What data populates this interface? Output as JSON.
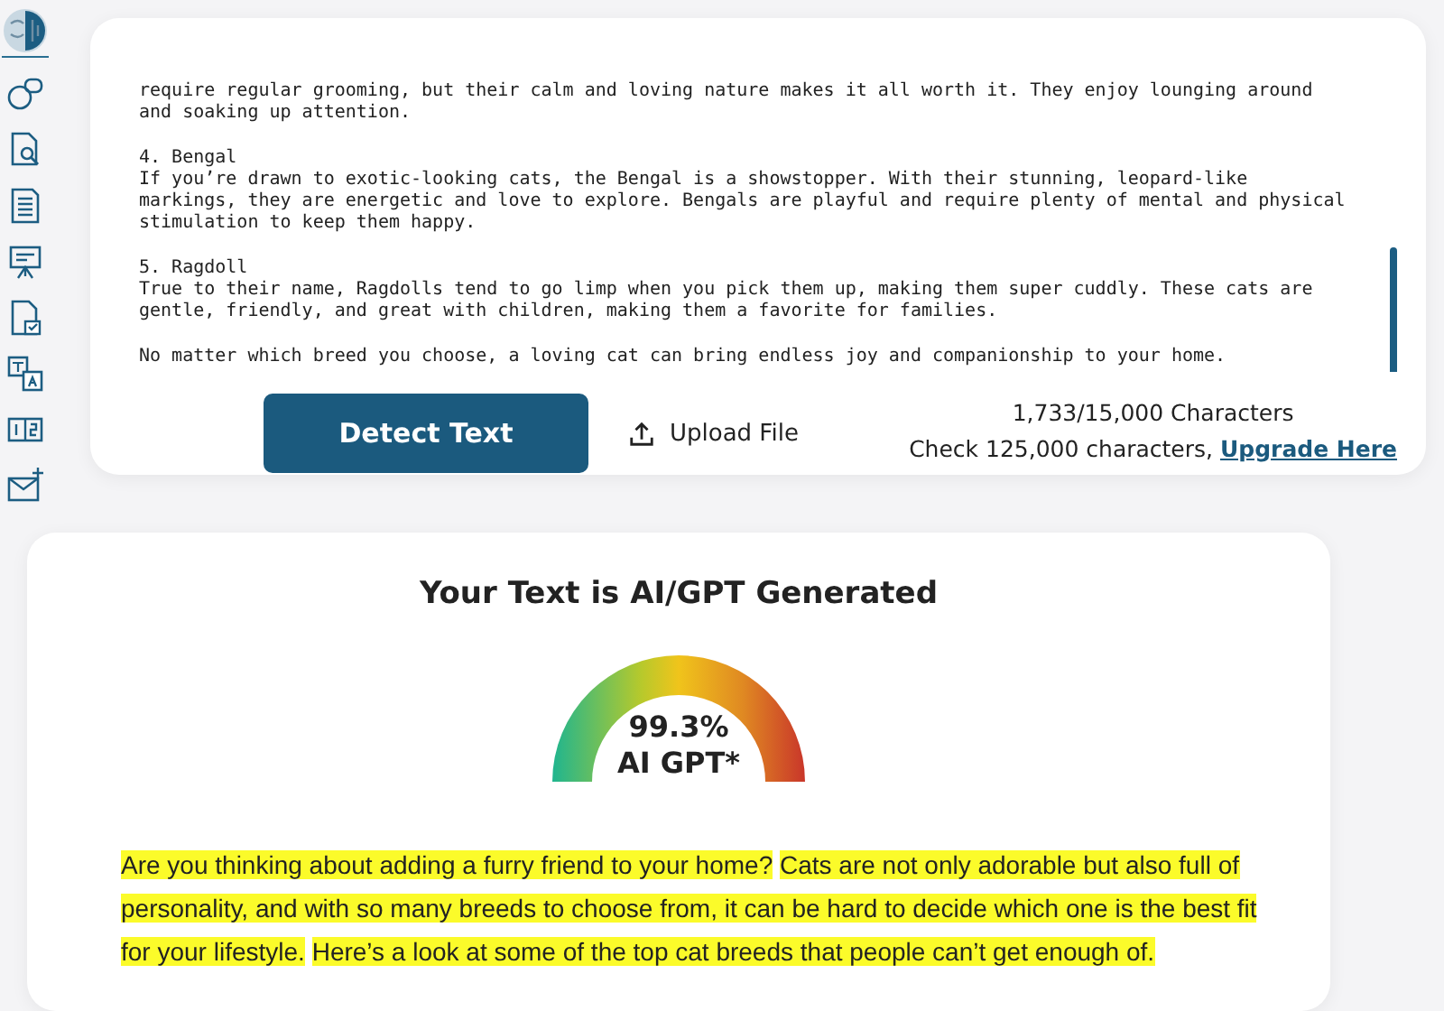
{
  "sidebar": {
    "items": [
      {
        "kind": "logo"
      },
      {
        "kind": "chat"
      },
      {
        "kind": "doc-search"
      },
      {
        "kind": "doc-list"
      },
      {
        "kind": "board"
      },
      {
        "kind": "doc-check"
      },
      {
        "kind": "translate"
      },
      {
        "kind": "numbers"
      },
      {
        "kind": "mail"
      }
    ]
  },
  "editor": {
    "paragraphs": [
      {
        "lines": [
          "require regular grooming, but their calm and loving nature makes it all worth it. They enjoy lounging around",
          "and soaking up attention."
        ]
      },
      {
        "lines": [
          "4. Bengal",
          "If you’re drawn to exotic-looking cats, the Bengal is a showstopper. With their stunning, leopard-like",
          "markings, they are energetic and love to explore. Bengals are playful and require plenty of mental and physical",
          "stimulation to keep them happy."
        ]
      },
      {
        "lines": [
          "5. Ragdoll",
          "True to their name, Ragdolls tend to go limp when you pick them up, making them super cuddly. These cats are",
          "gentle, friendly, and great with children, making them a favorite for families."
        ]
      },
      {
        "lines": [
          "No matter which breed you choose, a loving cat can bring endless joy and companionship to your home."
        ]
      }
    ],
    "detect_button": "Detect Text",
    "upload_button": "Upload File",
    "char_count": "1,733/15,000 Characters",
    "upgrade_note": "Check 125,000 characters,",
    "upgrade_link": "Upgrade Here"
  },
  "result": {
    "title": "Your Text is AI/GPT Generated",
    "gauge": {
      "percent": "99.3%",
      "label": "AI GPT*"
    },
    "sentences": [
      {
        "text": "Are you thinking about adding a furry friend to your home?",
        "highlighted": true
      },
      {
        "text": "Cats are not only adorable but also full of personality, and with so many breeds to choose from, it can be hard to decide which one is the best fit for your lifestyle.",
        "highlighted": true
      },
      {
        "text": "Here’s a look at some of the top cat breeds that people can’t get enough of.",
        "highlighted": true
      }
    ]
  }
}
